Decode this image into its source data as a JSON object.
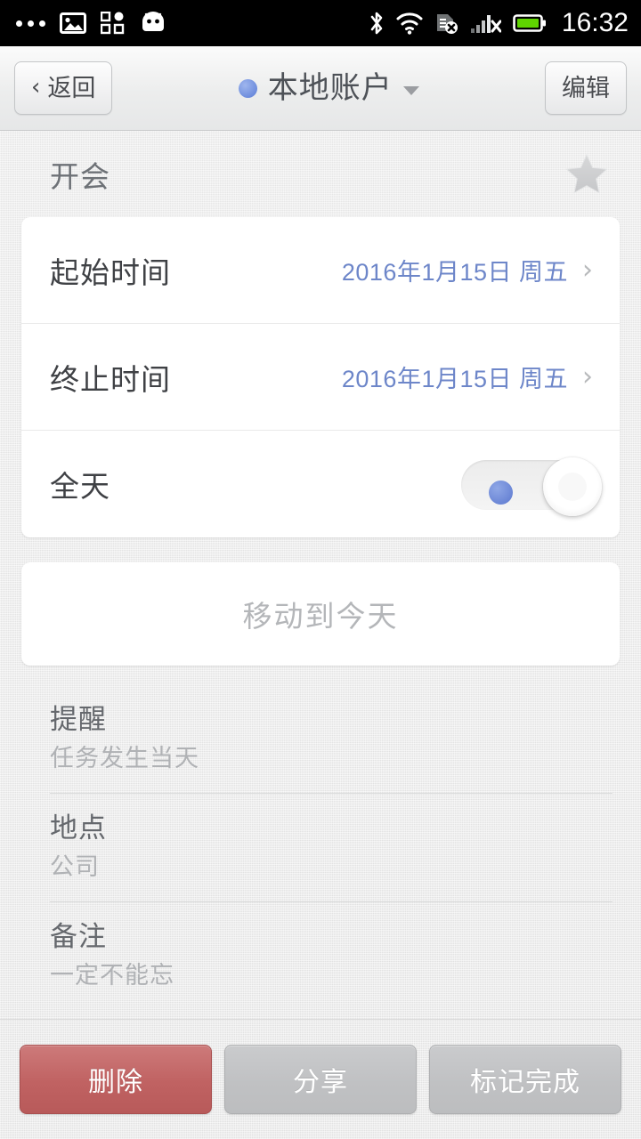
{
  "status_bar": {
    "time": "16:32",
    "left_icons": [
      "more-dots-icon",
      "image-icon",
      "apps-grid-icon",
      "android-robot-icon"
    ],
    "right_icons": [
      "bluetooth-icon",
      "wifi-icon",
      "sim-card-off-icon",
      "signal-off-icon",
      "battery-icon"
    ],
    "battery_color": "#5fd400"
  },
  "nav": {
    "back_label": "返回",
    "back_chevron": "‹",
    "title": "本地账户",
    "account_dot_color": "#6e8ddd",
    "edit_label": "编辑"
  },
  "event": {
    "title": "开会",
    "starred": false,
    "star_icon": "star-icon"
  },
  "time_card": {
    "rows": [
      {
        "label": "起始时间",
        "value": "2016年1月15日 周五",
        "chevron": "›"
      },
      {
        "label": "终止时间",
        "value": "2016年1月15日 周五",
        "chevron": "›"
      }
    ],
    "value_color": "#6d86c9",
    "all_day": {
      "label": "全天",
      "enabled": false
    }
  },
  "move_action": {
    "label": "移动到今天"
  },
  "details": [
    {
      "label": "提醒",
      "value": "任务发生当天"
    },
    {
      "label": "地点",
      "value": "公司"
    },
    {
      "label": "备注",
      "value": "一定不能忘"
    }
  ],
  "bottom_bar": {
    "delete_label": "删除",
    "share_label": "分享",
    "complete_label": "标记完成",
    "delete_color": "#c06262"
  }
}
